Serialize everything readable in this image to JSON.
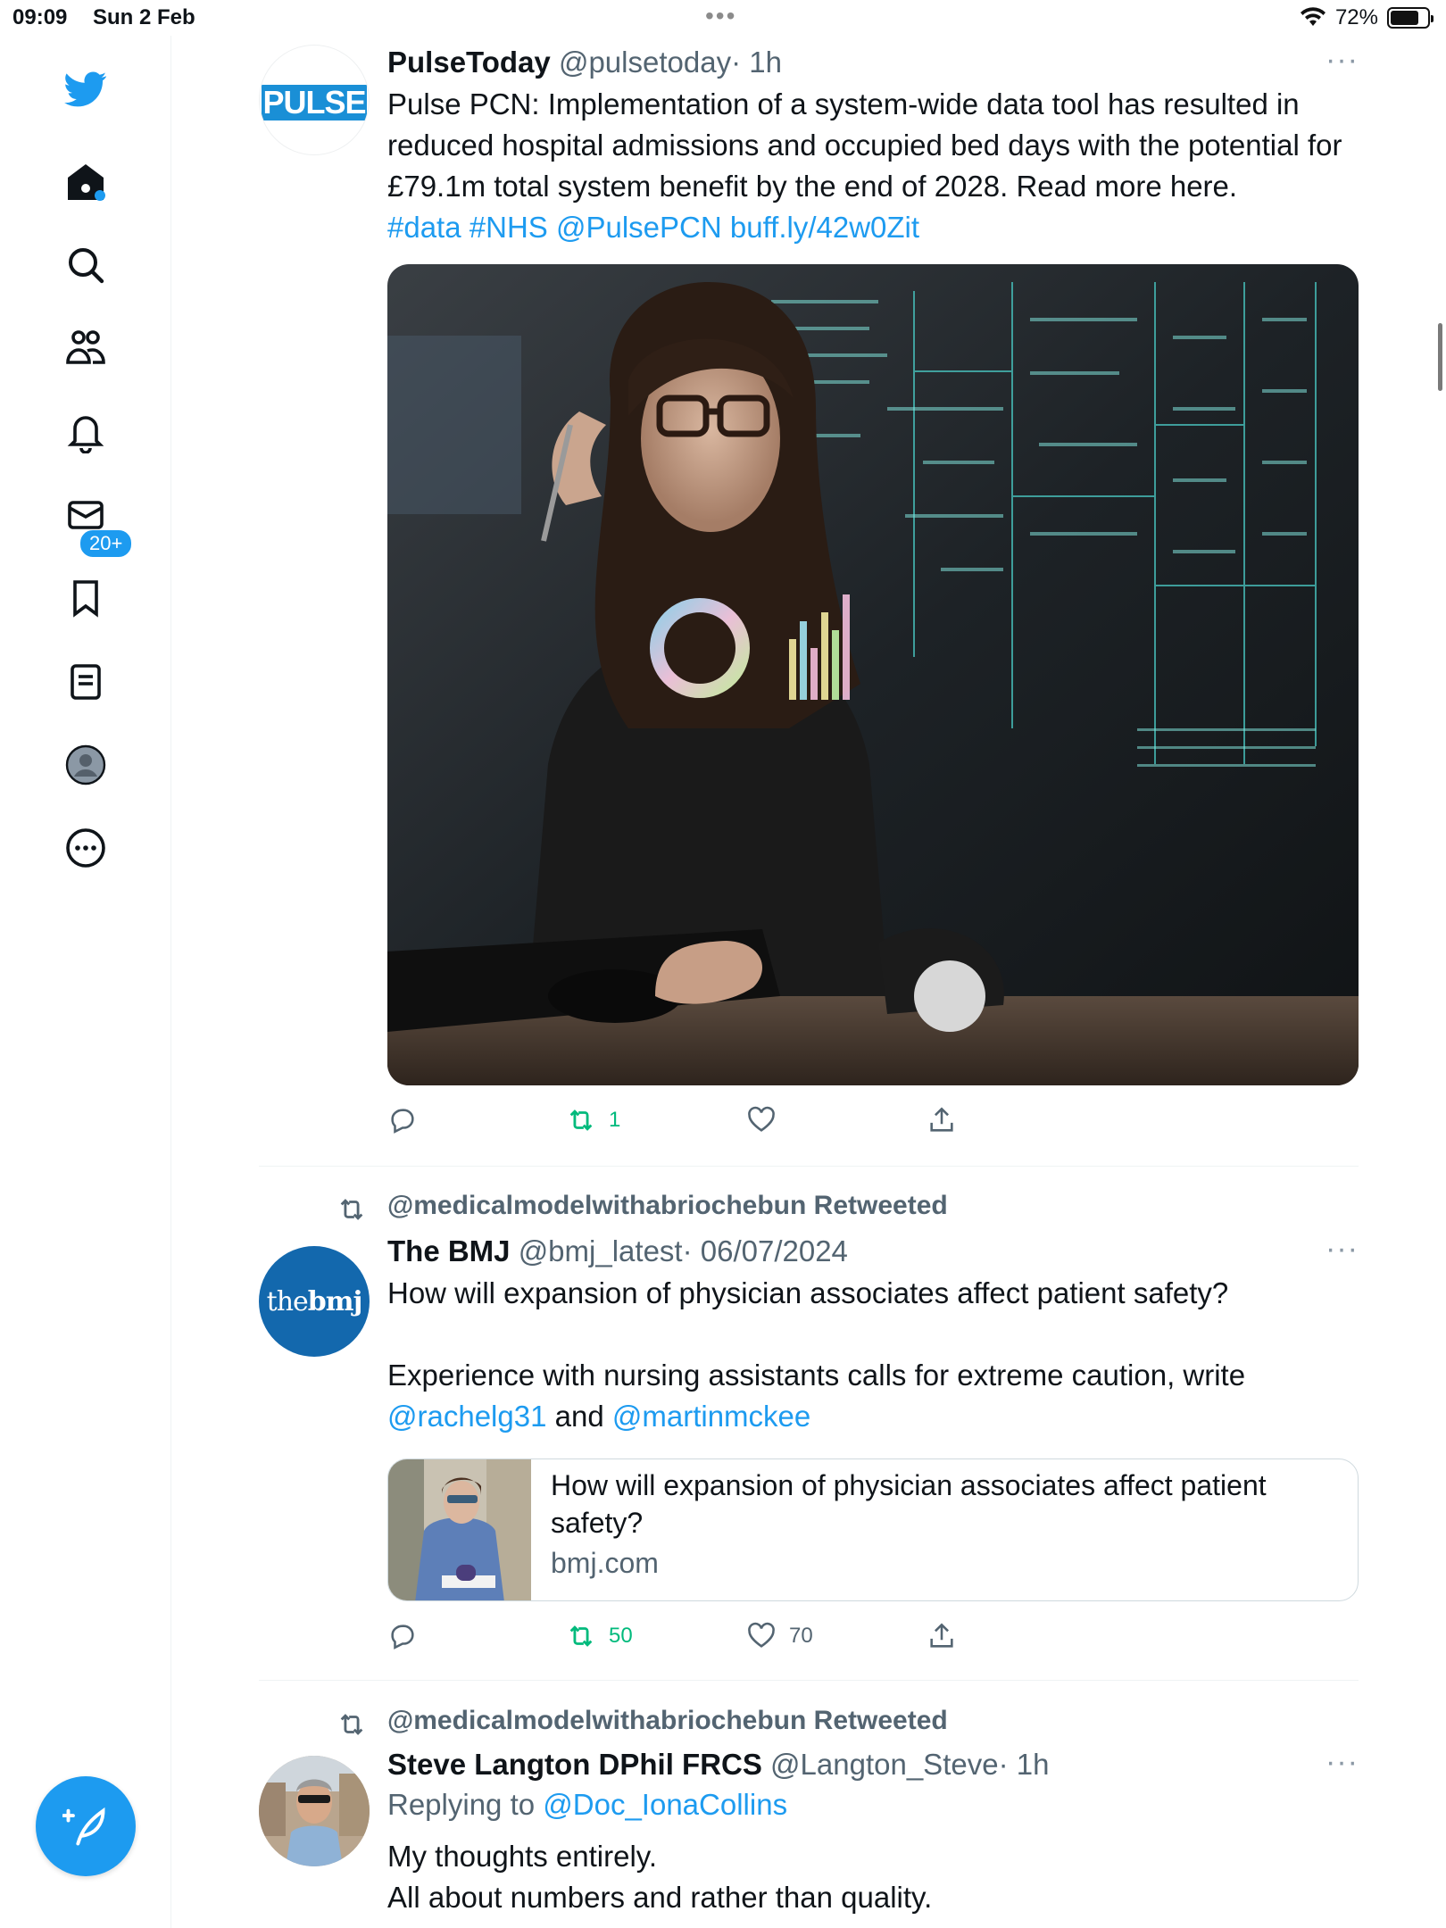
{
  "status_bar": {
    "time": "09:09",
    "date": "Sun 2 Feb",
    "battery": "72%"
  },
  "sidebar": {
    "notifications_badge": "20+"
  },
  "tweets": [
    {
      "name": "PulseToday",
      "handle": "@pulsetoday",
      "time": "· 1h",
      "avatar_text": "PULSE",
      "text": "Pulse PCN:  Implementation of a system-wide data tool has resulted in reduced hospital admissions and occupied bed days with the potential for £79.1m total system benefit by the end of 2028. Read more here.",
      "links": [
        "#data",
        "#NHS",
        "@PulsePCN",
        "buff.ly/42w0Zit"
      ],
      "retweets": "1"
    },
    {
      "retweeted_by": "@medicalmodelwithabriochebun Retweeted",
      "name": "The BMJ",
      "handle": "@bmj_latest",
      "time": "· 06/07/2024",
      "avatar_text_a": "the",
      "avatar_text_b": "bmj",
      "text_1": "How will expansion of physician associates affect patient safety?",
      "text_2": "Experience with nursing assistants calls for extreme caution, write",
      "mention_1": "@rachelg31",
      "and": " and ",
      "mention_2": "@martinmckee",
      "card_title": "How will expansion of physician associates affect patient safety?",
      "card_domain": "bmj.com",
      "retweets": "50",
      "likes": "70"
    },
    {
      "retweeted_by": "@medicalmodelwithabriochebun Retweeted",
      "name": "Steve Langton DPhil FRCS",
      "handle": "@Langton_Steve",
      "time": "· 1h",
      "replying_prefix": "Replying to ",
      "replying_to": "@Doc_IonaCollins",
      "line_1": "My thoughts entirely.",
      "line_2": "All about numbers and rather than quality."
    }
  ],
  "more_label": "···"
}
